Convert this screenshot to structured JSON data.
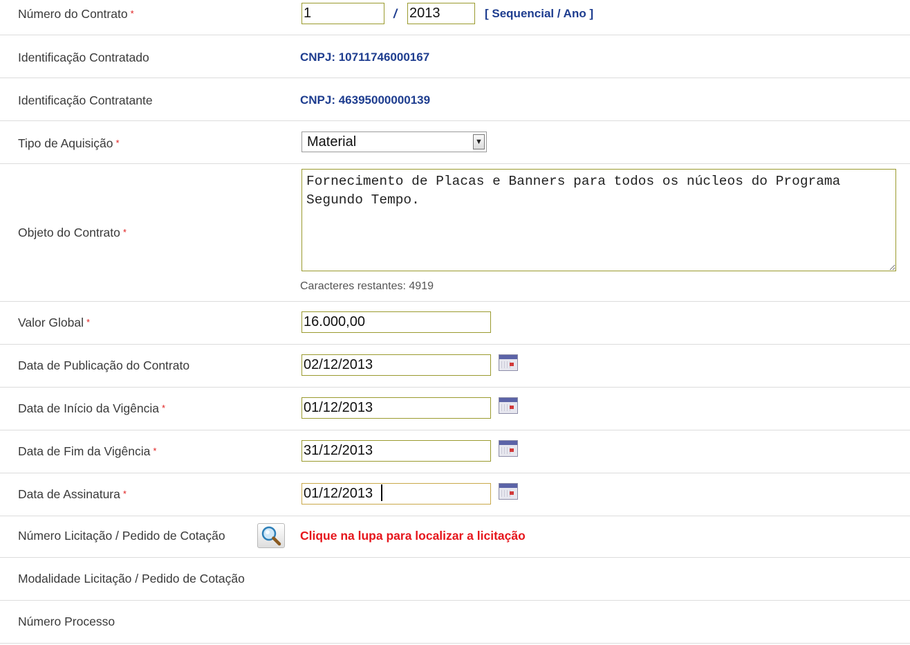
{
  "rows": {
    "numero_contrato": {
      "label": "Número do Contrato",
      "required": "*",
      "sequencial": "1",
      "ano": "2013",
      "separator": "/",
      "hint": "[ Sequencial / Ano ]"
    },
    "id_contratado": {
      "label": "Identificação Contratado",
      "value": "CNPJ: 10711746000167"
    },
    "id_contratante": {
      "label": "Identificação Contratante",
      "value": "CNPJ: 46395000000139"
    },
    "tipo_aquisicao": {
      "label": "Tipo de Aquisição",
      "required": "*",
      "selected": "Material"
    },
    "objeto": {
      "label": "Objeto do Contrato",
      "required": "*",
      "text": "Fornecimento de Placas e Banners para todos os núcleos do Programa Segundo Tempo.",
      "counter": "Caracteres restantes: 4919"
    },
    "valor_global": {
      "label": "Valor Global",
      "required": "*",
      "value": "16.000,00"
    },
    "data_publicacao": {
      "label": "Data de Publicação do Contrato",
      "value": "02/12/2013"
    },
    "data_inicio": {
      "label": "Data de Início da Vigência",
      "required": "*",
      "value": "01/12/2013"
    },
    "data_fim": {
      "label": "Data de Fim da Vigência",
      "required": "*",
      "value": "31/12/2013"
    },
    "data_assinatura": {
      "label": "Data de Assinatura",
      "required": "*",
      "value": "01/12/2013"
    },
    "numero_licitacao": {
      "label": "Número Licitação / Pedido de Cotação",
      "message": "Clique na lupa para localizar a licitação"
    },
    "modalidade": {
      "label": "Modalidade Licitação / Pedido de Cotação"
    },
    "numero_processo": {
      "label": "Número Processo"
    }
  },
  "icons": {
    "calendar": "calendar-icon",
    "search": "magnifier-icon",
    "dropdown": "chevron-down-icon"
  },
  "colors": {
    "required": "#e02020",
    "link": "#1e3d8f",
    "warning": "#e6161c",
    "field_border": "#9a9a2e"
  }
}
